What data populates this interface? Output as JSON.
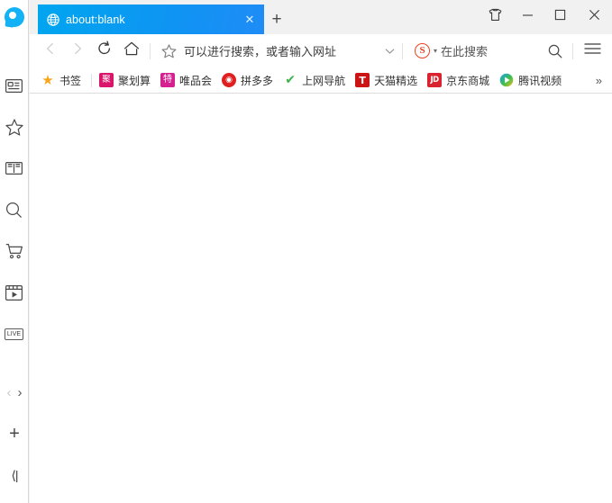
{
  "window": {
    "controls": [
      {
        "name": "skin-button",
        "label": "",
        "icon": "tshirt-icon"
      },
      {
        "name": "minimize-button",
        "label": "—",
        "icon": "minimize-icon"
      },
      {
        "name": "maximize-button",
        "label": "□",
        "icon": "maximize-icon"
      },
      {
        "name": "close-button",
        "label": "✕",
        "icon": "close-icon"
      }
    ]
  },
  "sidebar": {
    "logo": "qq-browser-logo",
    "items": [
      {
        "name": "sidebar-item-news",
        "icon": "news-card-icon"
      },
      {
        "name": "sidebar-item-favorites",
        "icon": "star-icon"
      },
      {
        "name": "sidebar-item-novel",
        "icon": "book-icon"
      },
      {
        "name": "sidebar-item-search",
        "icon": "search-icon"
      },
      {
        "name": "sidebar-item-shopping",
        "icon": "cart-icon"
      },
      {
        "name": "sidebar-item-video",
        "icon": "video-player-icon"
      },
      {
        "name": "sidebar-item-live",
        "icon": "live-badge-icon",
        "label": "LIVE"
      }
    ],
    "bottom": {
      "prev_label": "‹",
      "next_label": "›",
      "add_label": "+",
      "collapse_label": "⟨|"
    }
  },
  "tabs": {
    "items": [
      {
        "title": "about:blank",
        "favicon": "globe-icon",
        "active": true,
        "close_label": "✕"
      }
    ],
    "new_tab_label": "+"
  },
  "toolbar": {
    "back": {
      "name": "back-button",
      "label": "‹",
      "enabled": false
    },
    "forward": {
      "name": "forward-button",
      "label": "›",
      "enabled": false
    },
    "reload": {
      "name": "reload-button",
      "icon": "reload-icon"
    },
    "home": {
      "name": "home-button",
      "icon": "home-icon"
    },
    "address": {
      "value": "",
      "placeholder": "可以进行搜索，或者输入网址",
      "star_icon": "star-outline-icon",
      "dropdown_label": "∨"
    },
    "search": {
      "engine": "S",
      "engine_name": "sogou-logo",
      "dropdown_label": "▾",
      "placeholder": "在此搜索",
      "value": "",
      "search_icon": "magnifier-icon"
    },
    "menu": {
      "name": "main-menu-button",
      "icon": "hamburger-icon"
    }
  },
  "bookmarks": {
    "items": [
      {
        "label": "书签",
        "icon": "star-icon",
        "icon_class": "fi-star",
        "icon_text": "★"
      },
      {
        "label": "聚划算",
        "icon": "juhuasuan-icon",
        "icon_class": "fi-ju",
        "icon_text": "聚"
      },
      {
        "label": "唯品会",
        "icon": "vipshop-icon",
        "icon_class": "fi-te",
        "icon_text": "特"
      },
      {
        "label": "拼多多",
        "icon": "pinduoduo-icon",
        "icon_class": "fi-pdd",
        "icon_text": "◉"
      },
      {
        "label": "上网导航",
        "icon": "hao123-icon",
        "icon_class": "fi-hao",
        "icon_text": "✔"
      },
      {
        "label": "天猫精选",
        "icon": "tmall-icon",
        "icon_class": "fi-tm",
        "icon_text": "T"
      },
      {
        "label": "京东商城",
        "icon": "jd-icon",
        "icon_class": "fi-jd",
        "icon_text": "JD"
      },
      {
        "label": "腾讯视频",
        "icon": "tencent-video-icon",
        "icon_class": "fi-tx",
        "icon_text": ""
      }
    ],
    "overflow_label": "»"
  },
  "page": {
    "url": "about:blank",
    "body_text": ""
  },
  "colors": {
    "tab_active_left": "#00a6ef",
    "tab_active_right": "#1f8cf6",
    "chrome_bg": "#f1f1f1",
    "toolbar_bg": "#ffffff",
    "page_bg": "#ffffff",
    "brand": "#13b1f5"
  }
}
